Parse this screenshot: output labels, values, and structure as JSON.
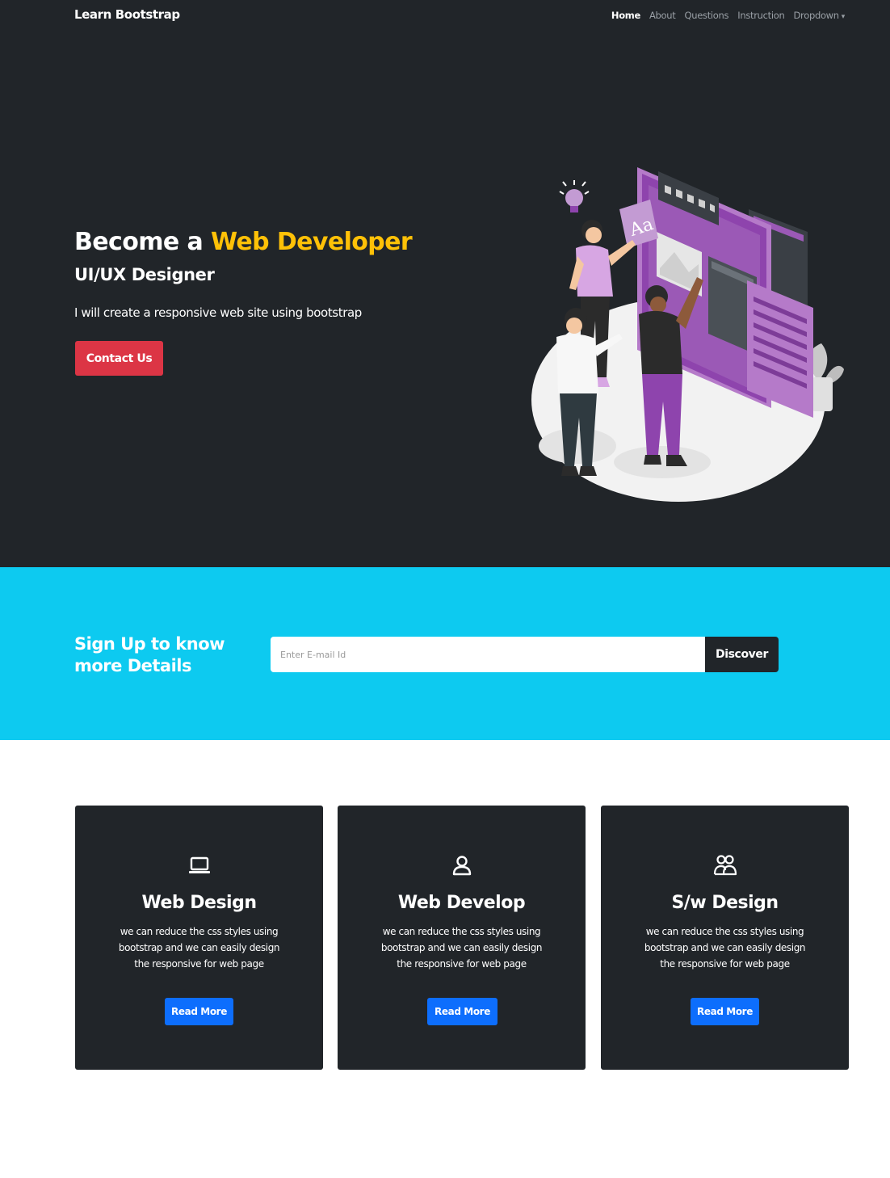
{
  "navbar": {
    "brand": "Learn Bootstrap",
    "links": [
      {
        "label": "Home",
        "active": true
      },
      {
        "label": "About"
      },
      {
        "label": "Questions"
      },
      {
        "label": "Instruction"
      },
      {
        "label": "Dropdown"
      }
    ]
  },
  "hero": {
    "title_prefix": "Become a ",
    "title_accent": "Web Developer",
    "subtitle": "UI/UX Designer",
    "lead": "I will create a responsive web site using bootstrap",
    "cta_label": "Contact Us",
    "illustration_text": "Aa"
  },
  "signup": {
    "title": "Sign Up to know more Details",
    "input_placeholder": "Enter E-mail Id",
    "input_value": "",
    "button_label": "Discover"
  },
  "cards": [
    {
      "icon": "laptop-icon",
      "title": "Web Design",
      "text": "we can reduce the css styles using bootstrap and we can easily design the responsive for web page",
      "button": "Read More"
    },
    {
      "icon": "person-icon",
      "title": "Web Develop",
      "text": "we can reduce the css styles using bootstrap and we can easily design the responsive for web page",
      "button": "Read More"
    },
    {
      "icon": "people-icon",
      "title": "S/w Design",
      "text": "we can reduce the css styles using bootstrap and we can easily design the responsive for web page",
      "button": "Read More"
    }
  ],
  "colors": {
    "dark": "#212529",
    "accent_yellow": "#ffc107",
    "danger": "#dc3545",
    "info": "#0dcaf0",
    "primary": "#0d6efd",
    "illustration_purple": "#9b59b6"
  }
}
